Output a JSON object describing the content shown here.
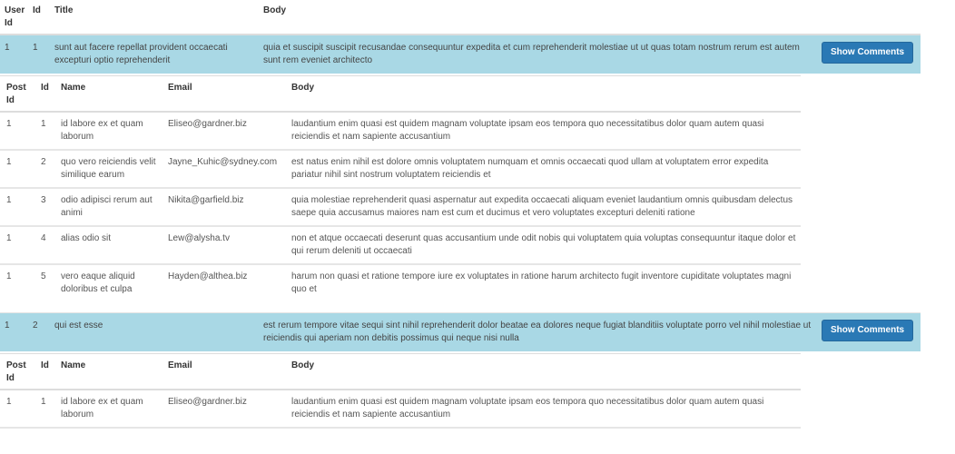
{
  "posts_table": {
    "headers": {
      "user_id": "User Id",
      "id": "Id",
      "title": "Title",
      "body": "Body"
    },
    "show_comments_label": "Show Comments",
    "colors": {
      "row_highlight": "#a9d8e5",
      "button": "#2a79b5"
    }
  },
  "comments_headers": {
    "post_id": "Post Id",
    "id": "Id",
    "name": "Name",
    "email": "Email",
    "body": "Body"
  },
  "posts": [
    {
      "user_id": "1",
      "id": "1",
      "title": "sunt aut facere repellat provident occaecati excepturi optio reprehenderit",
      "body": "quia et suscipit suscipit recusandae consequuntur expedita et cum reprehenderit molestiae ut ut quas totam nostrum rerum est autem sunt rem eveniet architecto",
      "comments": [
        {
          "post_id": "1",
          "id": "1",
          "name": "id labore ex et quam laborum",
          "email": "Eliseo@gardner.biz",
          "body": "laudantium enim quasi est quidem magnam voluptate ipsam eos tempora quo necessitatibus dolor quam autem quasi reiciendis et nam sapiente accusantium"
        },
        {
          "post_id": "1",
          "id": "2",
          "name": "quo vero reiciendis velit similique earum",
          "email": "Jayne_Kuhic@sydney.com",
          "body": "est natus enim nihil est dolore omnis voluptatem numquam et omnis occaecati quod ullam at voluptatem error expedita pariatur nihil sint nostrum voluptatem reiciendis et"
        },
        {
          "post_id": "1",
          "id": "3",
          "name": "odio adipisci rerum aut animi",
          "email": "Nikita@garfield.biz",
          "body": "quia molestiae reprehenderit quasi aspernatur aut expedita occaecati aliquam eveniet laudantium omnis quibusdam delectus saepe quia accusamus maiores nam est cum et ducimus et vero voluptates excepturi deleniti ratione"
        },
        {
          "post_id": "1",
          "id": "4",
          "name": "alias odio sit",
          "email": "Lew@alysha.tv",
          "body": "non et atque occaecati deserunt quas accusantium unde odit nobis qui voluptatem quia voluptas consequuntur itaque dolor et qui rerum deleniti ut occaecati"
        },
        {
          "post_id": "1",
          "id": "5",
          "name": "vero eaque aliquid doloribus et culpa",
          "email": "Hayden@althea.biz",
          "body": "harum non quasi et ratione tempore iure ex voluptates in ratione harum architecto fugit inventore cupiditate voluptates magni quo et"
        }
      ]
    },
    {
      "user_id": "1",
      "id": "2",
      "title": "qui est esse",
      "body": "est rerum tempore vitae sequi sint nihil reprehenderit dolor beatae ea dolores neque fugiat blanditiis voluptate porro vel nihil molestiae ut reiciendis qui aperiam non debitis possimus qui neque nisi nulla",
      "comments": [
        {
          "post_id": "1",
          "id": "1",
          "name": "id labore ex et quam laborum",
          "email": "Eliseo@gardner.biz",
          "body": "laudantium enim quasi est quidem magnam voluptate ipsam eos tempora quo necessitatibus dolor quam autem quasi reiciendis et nam sapiente accusantium"
        }
      ]
    }
  ]
}
